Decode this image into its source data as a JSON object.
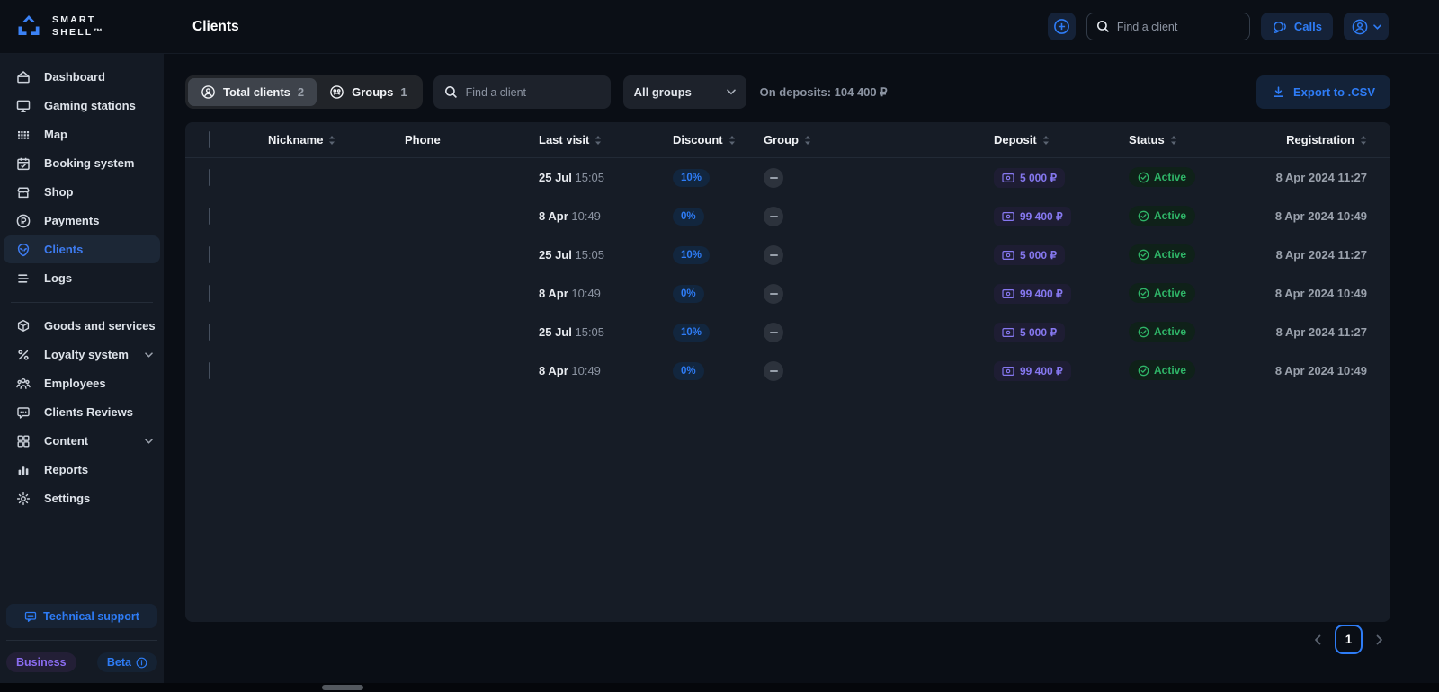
{
  "brand": {
    "line1": "SMART",
    "line2": "SHELL™"
  },
  "topbar": {
    "title": "Clients",
    "search_placeholder": "Find a client",
    "calls_label": "Calls"
  },
  "sidebar": {
    "items": [
      {
        "label": "Dashboard"
      },
      {
        "label": "Gaming stations"
      },
      {
        "label": "Map"
      },
      {
        "label": "Booking system"
      },
      {
        "label": "Shop"
      },
      {
        "label": "Payments"
      },
      {
        "label": "Clients",
        "active": true
      },
      {
        "label": "Logs"
      },
      {
        "label": "Goods and services",
        "expandable": true
      },
      {
        "label": "Loyalty system",
        "expandable": true
      },
      {
        "label": "Employees"
      },
      {
        "label": "Clients Reviews"
      },
      {
        "label": "Content",
        "expandable": true
      },
      {
        "label": "Reports"
      },
      {
        "label": "Settings"
      }
    ],
    "support_label": "Technical support",
    "business_badge": "Business",
    "beta_badge": "Beta"
  },
  "filters": {
    "tabs": [
      {
        "label": "Total clients",
        "count": "2",
        "active": true
      },
      {
        "label": "Groups",
        "count": "1",
        "active": false
      }
    ],
    "search_placeholder": "Find a client",
    "group_select_value": "All groups",
    "deposits_summary": "On deposits: 104 400 ₽",
    "export_label": "Export to .CSV"
  },
  "table": {
    "headers": [
      "Nickname",
      "Phone",
      "Last visit",
      "Discount",
      "Group",
      "Deposit",
      "Status",
      "Registration"
    ],
    "rows": [
      {
        "last_visit_date": "25 Jul",
        "last_visit_time": "15:05",
        "discount": "10%",
        "group": "—",
        "deposit": "5 000 ₽",
        "status": "Active",
        "registration": "8 Apr 2024 11:27"
      },
      {
        "last_visit_date": "8 Apr",
        "last_visit_time": "10:49",
        "discount": "0%",
        "group": "—",
        "deposit": "99 400 ₽",
        "status": "Active",
        "registration": "8 Apr 2024 10:49"
      },
      {
        "last_visit_date": "25 Jul",
        "last_visit_time": "15:05",
        "discount": "10%",
        "group": "—",
        "deposit": "5 000 ₽",
        "status": "Active",
        "registration": "8 Apr 2024 11:27"
      },
      {
        "last_visit_date": "8 Apr",
        "last_visit_time": "10:49",
        "discount": "0%",
        "group": "—",
        "deposit": "99 400 ₽",
        "status": "Active",
        "registration": "8 Apr 2024 10:49"
      },
      {
        "last_visit_date": "25 Jul",
        "last_visit_time": "15:05",
        "discount": "10%",
        "group": "—",
        "deposit": "5 000 ₽",
        "status": "Active",
        "registration": "8 Apr 2024 11:27"
      },
      {
        "last_visit_date": "8 Apr",
        "last_visit_time": "10:49",
        "discount": "0%",
        "group": "—",
        "deposit": "99 400 ₽",
        "status": "Active",
        "registration": "8 Apr 2024 10:49"
      }
    ]
  },
  "pagination": {
    "current_page": "1"
  },
  "colors": {
    "accent": "#2e7cf6",
    "purple": "#8678f0",
    "green": "#2fb568"
  }
}
